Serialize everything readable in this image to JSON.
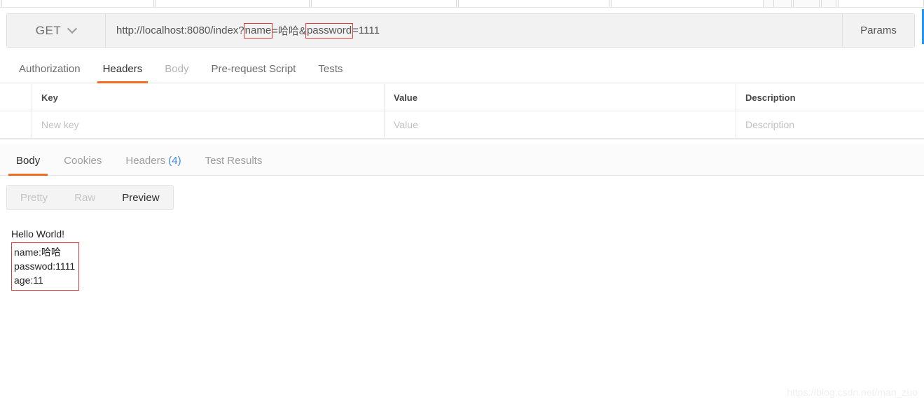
{
  "request": {
    "method": "GET",
    "method_dropdown_icon": "chevron-down-icon",
    "url_prefix": "http://localhost:8080/index?",
    "url_param_name_key": "name",
    "url_param_name_sep": "=哈哈&",
    "url_param_pass_key": "password",
    "url_param_pass_val": "=1111",
    "url_full": "http://localhost:8080/index?name=哈哈&password=1111",
    "params_button": "Params"
  },
  "request_tabs": [
    {
      "label": "Authorization",
      "state": "enabled"
    },
    {
      "label": "Headers",
      "state": "active"
    },
    {
      "label": "Body",
      "state": "disabled"
    },
    {
      "label": "Pre-request Script",
      "state": "enabled"
    },
    {
      "label": "Tests",
      "state": "enabled"
    }
  ],
  "headers_table": {
    "columns": [
      "Key",
      "Value",
      "Description"
    ],
    "new_row": {
      "key_placeholder": "New key",
      "value_placeholder": "Value",
      "description_placeholder": "Description"
    }
  },
  "response_tabs": [
    {
      "label": "Body",
      "count": "",
      "state": "active"
    },
    {
      "label": "Cookies",
      "count": "",
      "state": "inactive"
    },
    {
      "label": "Headers",
      "count": "(4)",
      "state": "inactive"
    },
    {
      "label": "Test Results",
      "count": "",
      "state": "inactive"
    }
  ],
  "format_toggle": [
    {
      "label": "Pretty",
      "state": "inactive"
    },
    {
      "label": "Raw",
      "state": "inactive"
    },
    {
      "label": "Preview",
      "state": "active"
    }
  ],
  "response_body": {
    "greeting": "Hello World!",
    "highlighted_lines": [
      "name:哈哈",
      "passwod:1111",
      "age:11"
    ]
  },
  "watermark": "https://blog.csdn.net/man_zuo",
  "colors": {
    "accent_orange": "#f26b21",
    "annotation_red": "#e03a3a",
    "link_blue": "#3f8ae0",
    "right_edge_blue": "#2196f3"
  }
}
